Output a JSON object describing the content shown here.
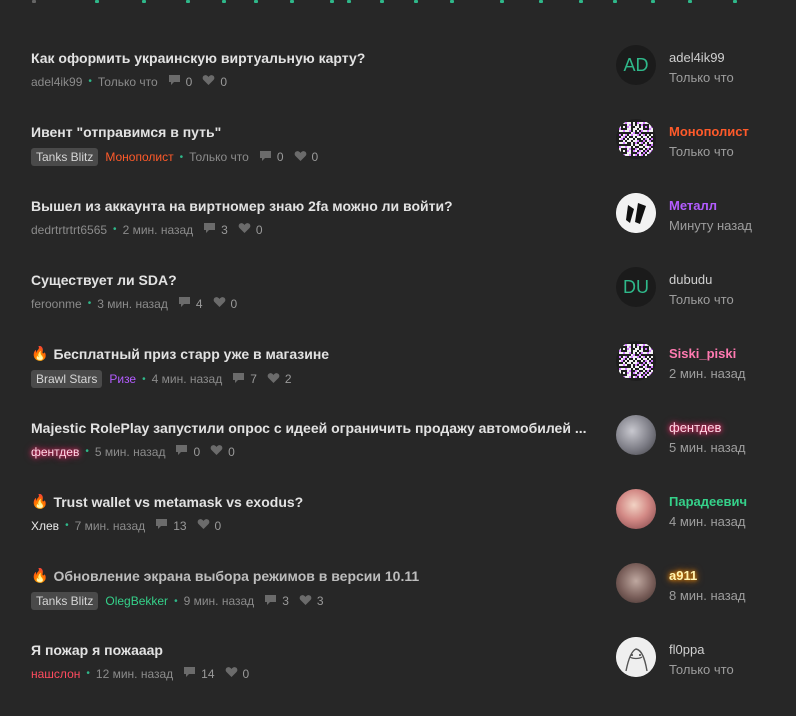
{
  "threads": [
    {
      "title": "Как оформить украинскую виртуальную карту?",
      "hot": false,
      "muted": false,
      "tag": "",
      "author": "adel4ik99",
      "author_color": "#8b8b8b",
      "time": "Только что",
      "replies": "0",
      "likes": "0",
      "last_user": "adel4ik99",
      "last_user_color": "#cfcfcf",
      "last_time": "Только что",
      "avatar_type": "initials",
      "avatar_initials": "AD"
    },
    {
      "title": "Ивент \"отправимся в путь\"",
      "hot": false,
      "muted": false,
      "tag": "Tanks Blitz",
      "author": "Монополист",
      "author_color": "#ff5a2a",
      "time": "Только что",
      "replies": "0",
      "likes": "0",
      "last_user": "Монополист",
      "last_user_color": "#ff5a2a",
      "last_time": "Только что",
      "avatar_type": "qr",
      "avatar_initials": ""
    },
    {
      "title": "Вышел из аккаунта на виртномер знаю 2fa можно ли войти?",
      "hot": false,
      "muted": false,
      "tag": "",
      "author": "dedrtrtrtrt6565",
      "author_color": "#8b8b8b",
      "time": "2 мин. назад",
      "replies": "3",
      "likes": "0",
      "last_user": "Металл",
      "last_user_color": "#b35cff",
      "last_time": "Минуту назад",
      "avatar_type": "logo",
      "avatar_initials": ""
    },
    {
      "title": "Существует ли SDA?",
      "hot": false,
      "muted": false,
      "tag": "",
      "author": "feroonme",
      "author_color": "#8b8b8b",
      "time": "3 мин. назад",
      "replies": "4",
      "likes": "0",
      "last_user": "dubudu",
      "last_user_color": "#cfcfcf",
      "last_time": "Только что",
      "avatar_type": "initials",
      "avatar_initials": "DU"
    },
    {
      "title": "Бесплатный приз старр уже в магазине",
      "hot": true,
      "muted": false,
      "tag": "Brawl Stars",
      "author": "Ризе",
      "author_color": "#b35cff",
      "time": "4 мин. назад",
      "replies": "7",
      "likes": "2",
      "last_user": "Siski_piski",
      "last_user_color": "#ff7ab1",
      "last_time": "2 мин. назад",
      "avatar_type": "qr",
      "avatar_initials": ""
    },
    {
      "title": "Majestic RolePlay запустили опрос с идеей ограничить продажу автомобилей ...",
      "hot": false,
      "muted": false,
      "tag": "",
      "author": "фентдев",
      "author_color": "glow-pink",
      "time": "5 мин. назад",
      "replies": "0",
      "likes": "0",
      "last_user": "фентдев",
      "last_user_color": "glow-pink",
      "last_time": "5 мин. назад",
      "avatar_type": "photo1",
      "avatar_initials": ""
    },
    {
      "title": "Trust wallet vs metamask vs exodus?",
      "hot": true,
      "muted": false,
      "tag": "",
      "author": "Хлев",
      "author_color": "#e8e8e8",
      "time": "7 мин. назад",
      "replies": "13",
      "likes": "0",
      "last_user": "Парадеевич",
      "last_user_color": "#35d18a",
      "last_time": "4 мин. назад",
      "avatar_type": "photo2",
      "avatar_initials": ""
    },
    {
      "title": "Обновление экрана выбора режимов в версии 10.11",
      "hot": true,
      "muted": true,
      "tag": "Tanks Blitz",
      "author": "OlegBekker",
      "author_color": "#35d18a",
      "time": "9 мин. назад",
      "replies": "3",
      "likes": "3",
      "last_user": "a911",
      "last_user_color": "glow-gold",
      "last_time": "8 мин. назад",
      "avatar_type": "photo3",
      "avatar_initials": ""
    },
    {
      "title": "Я пожар я пожааар",
      "hot": false,
      "muted": false,
      "tag": "",
      "author": "нашслон",
      "author_color": "#ff4b5f",
      "time": "12 мин. назад",
      "replies": "14",
      "likes": "0",
      "last_user": "fl0ppa",
      "last_user_color": "#cfcfcf",
      "last_time": "Только что",
      "avatar_type": "photo4",
      "avatar_initials": ""
    }
  ]
}
